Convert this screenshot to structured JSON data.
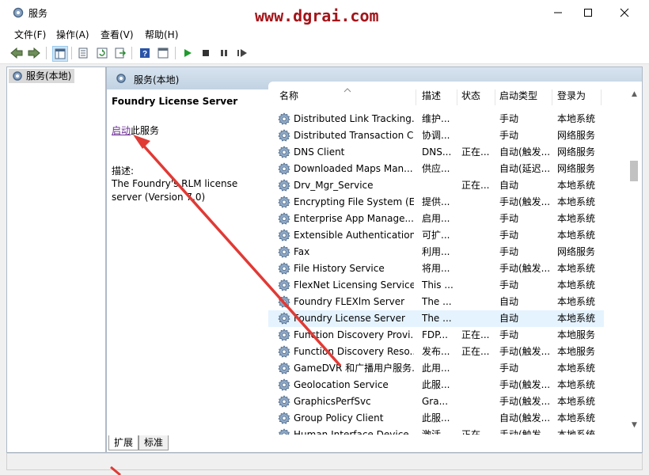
{
  "window": {
    "title": "服务",
    "watermark": "www.dgrai.com"
  },
  "menu": [
    "文件(F)",
    "操作(A)",
    "查看(V)",
    "帮助(H)"
  ],
  "tree": {
    "root": "服务(本地)"
  },
  "main": {
    "header": "服务(本地)",
    "selected_service": "Foundry License Server",
    "start_link": "启动",
    "start_suffix": "此服务",
    "desc_label": "描述:",
    "desc_text": "The Foundry's RLM license server (Version 7.0)"
  },
  "columns": [
    "名称",
    "描述",
    "状态",
    "启动类型",
    "登录为"
  ],
  "services": [
    {
      "name": "Distributed Link Tracking...",
      "desc": "维护...",
      "status": "",
      "startup": "手动",
      "logon": "本地系统"
    },
    {
      "name": "Distributed Transaction C...",
      "desc": "协调...",
      "status": "",
      "startup": "手动",
      "logon": "网络服务"
    },
    {
      "name": "DNS Client",
      "desc": "DNS...",
      "status": "正在...",
      "startup": "自动(触发...",
      "logon": "网络服务"
    },
    {
      "name": "Downloaded Maps Man...",
      "desc": "供应...",
      "status": "",
      "startup": "自动(延迟...",
      "logon": "网络服务"
    },
    {
      "name": "Drv_Mgr_Service",
      "desc": "",
      "status": "正在...",
      "startup": "自动",
      "logon": "本地系统"
    },
    {
      "name": "Encrypting File System (E...",
      "desc": "提供...",
      "status": "",
      "startup": "手动(触发...",
      "logon": "本地系统"
    },
    {
      "name": "Enterprise App Manage...",
      "desc": "启用...",
      "status": "",
      "startup": "手动",
      "logon": "本地系统"
    },
    {
      "name": "Extensible Authentication...",
      "desc": "可扩...",
      "status": "",
      "startup": "手动",
      "logon": "本地系统"
    },
    {
      "name": "Fax",
      "desc": "利用...",
      "status": "",
      "startup": "手动",
      "logon": "网络服务"
    },
    {
      "name": "File History Service",
      "desc": "将用...",
      "status": "",
      "startup": "手动(触发...",
      "logon": "本地系统"
    },
    {
      "name": "FlexNet Licensing Service",
      "desc": "This ...",
      "status": "",
      "startup": "手动",
      "logon": "本地系统"
    },
    {
      "name": "Foundry FLEXlm Server",
      "desc": "The ...",
      "status": "",
      "startup": "自动",
      "logon": "本地系统"
    },
    {
      "name": "Foundry License Server",
      "desc": "The ...",
      "status": "",
      "startup": "自动",
      "logon": "本地系统",
      "selected": true
    },
    {
      "name": "Function Discovery Provi...",
      "desc": "FDP...",
      "status": "正在...",
      "startup": "手动",
      "logon": "本地服务"
    },
    {
      "name": "Function Discovery Reso...",
      "desc": "发布...",
      "status": "正在...",
      "startup": "手动(触发...",
      "logon": "本地服务"
    },
    {
      "name": "GameDVR 和广播用户服务...",
      "desc": "此用...",
      "status": "",
      "startup": "手动",
      "logon": "本地系统"
    },
    {
      "name": "Geolocation Service",
      "desc": "此服...",
      "status": "",
      "startup": "手动(触发...",
      "logon": "本地系统"
    },
    {
      "name": "GraphicsPerfSvc",
      "desc": "Gra...",
      "status": "",
      "startup": "手动(触发...",
      "logon": "本地系统"
    },
    {
      "name": "Group Policy Client",
      "desc": "此服...",
      "status": "",
      "startup": "自动(触发...",
      "logon": "本地系统"
    },
    {
      "name": "Human Interface Device...",
      "desc": "激活...",
      "status": "正在...",
      "startup": "手动(触发...",
      "logon": "本地系统"
    }
  ],
  "tabs": [
    "扩展",
    "标准"
  ],
  "colors": {
    "accent": "#a3151a",
    "header": "#c8d7e6",
    "selection": "#e5f3ff",
    "link": "#6a2c91",
    "arrow": "#e03a35"
  }
}
